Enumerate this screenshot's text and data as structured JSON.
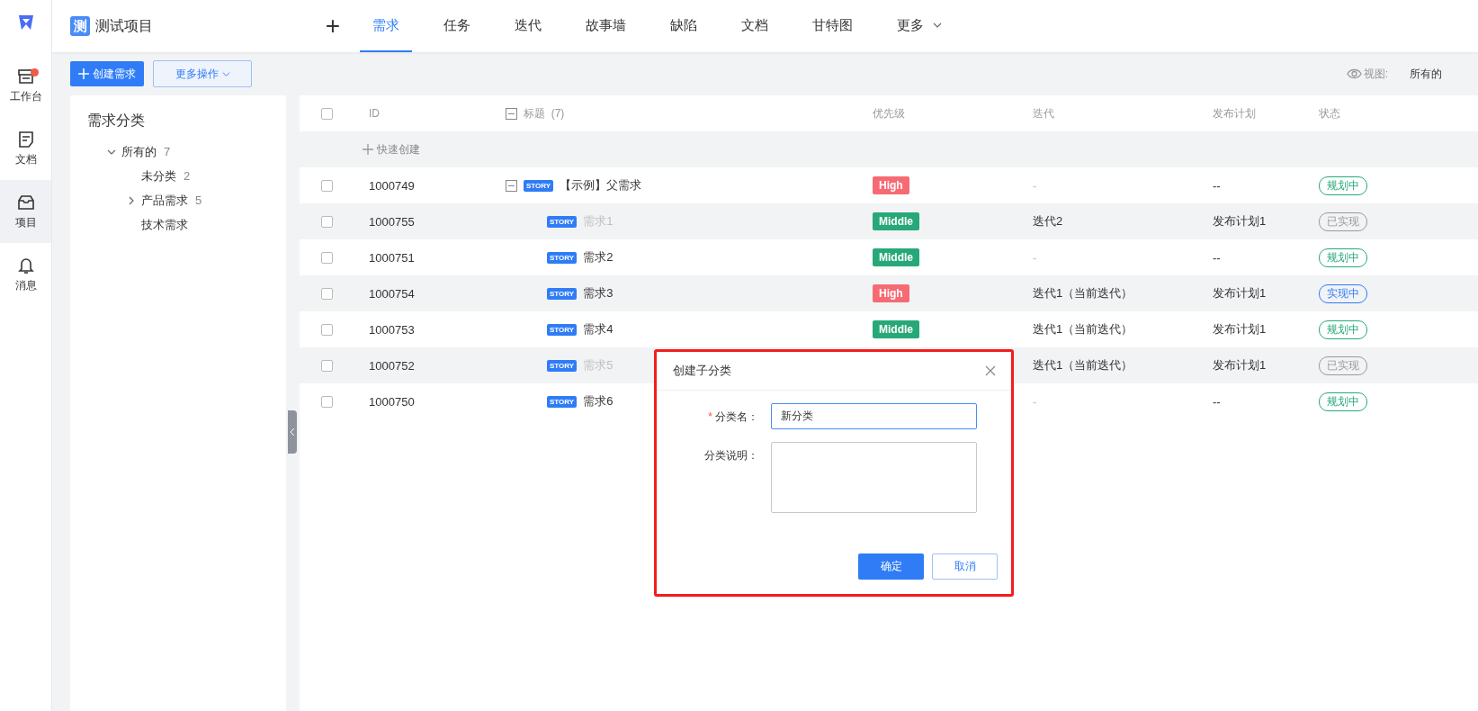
{
  "rail": {
    "items": [
      {
        "kind": "desk",
        "label": "工作台",
        "badge": true,
        "selected": false
      },
      {
        "kind": "doc",
        "label": "文档",
        "badge": false,
        "selected": false
      },
      {
        "kind": "project",
        "label": "项目",
        "badge": false,
        "selected": true
      },
      {
        "kind": "bell",
        "label": "消息",
        "badge": false,
        "selected": false
      }
    ]
  },
  "project": {
    "logo": "测",
    "name": "测试项目"
  },
  "nav": {
    "add": "+",
    "tabs": [
      {
        "label": "需求",
        "selected": true
      },
      {
        "label": "任务",
        "selected": false
      },
      {
        "label": "迭代",
        "selected": false
      },
      {
        "label": "故事墙",
        "selected": false
      },
      {
        "label": "缺陷",
        "selected": false
      },
      {
        "label": "文档",
        "selected": false
      },
      {
        "label": "甘特图",
        "selected": false
      },
      {
        "label": "更多",
        "selected": false,
        "dropdown": true
      }
    ]
  },
  "toolbar": {
    "create": "创建需求",
    "more": "更多操作",
    "view_label": "视图:",
    "view_value": "所有的"
  },
  "category_panel": {
    "title": "需求分类",
    "tree": [
      {
        "label": "所有的",
        "count": "7",
        "expanded": true,
        "children": [
          {
            "label": "未分类",
            "count": "2"
          },
          {
            "label": "产品需求",
            "count": "5",
            "expanded": false
          },
          {
            "label": "技术需求"
          }
        ]
      }
    ]
  },
  "table": {
    "all_checked": false,
    "columns": [
      "ID",
      "标题",
      "优先级",
      "迭代",
      "发布计划",
      "状态"
    ],
    "title_count": "(7)",
    "quick_create": "快速创建",
    "rows": [
      {
        "checked": false,
        "id": "1000749",
        "badge": "STORY",
        "title": "【示例】父需求",
        "muted": false,
        "priority": "High",
        "iteration": "-",
        "release": "--",
        "status": "规划中",
        "expanded": true,
        "children": [
          {
            "checked": false,
            "id": "1000755",
            "badge": "STORY",
            "title": "需求1",
            "muted": true,
            "priority": "Middle",
            "iteration": "迭代2",
            "release": "发布计划1",
            "status": "已实现"
          },
          {
            "checked": false,
            "id": "1000751",
            "badge": "STORY",
            "title": "需求2",
            "muted": false,
            "priority": "Middle",
            "iteration": "-",
            "release": "--",
            "status": "规划中"
          },
          {
            "checked": false,
            "id": "1000754",
            "badge": "STORY",
            "title": "需求3",
            "muted": false,
            "priority": "High",
            "iteration": "迭代1（当前迭代）",
            "release": "发布计划1",
            "status": "实现中"
          },
          {
            "checked": false,
            "id": "1000753",
            "badge": "STORY",
            "title": "需求4",
            "muted": false,
            "priority": "Middle",
            "iteration": "迭代1（当前迭代）",
            "release": "发布计划1",
            "status": "规划中"
          },
          {
            "checked": false,
            "id": "1000752",
            "badge": "STORY",
            "title": "需求5",
            "muted": true,
            "iteration": "迭代1（当前迭代）",
            "release": "发布计划1",
            "status": "已实现"
          },
          {
            "checked": false,
            "id": "1000750",
            "badge": "STORY",
            "title": "需求6",
            "muted": false,
            "iteration": "-",
            "release": "--",
            "status": "规划中"
          }
        ]
      }
    ]
  },
  "dialog": {
    "title": "创建子分类",
    "fields": [
      {
        "kind": "input",
        "label": "分类名：",
        "required_mark": "*",
        "value": "新分类"
      },
      {
        "kind": "textarea",
        "label": "分类说明："
      }
    ],
    "ok": "确定",
    "cancel": "取消"
  }
}
